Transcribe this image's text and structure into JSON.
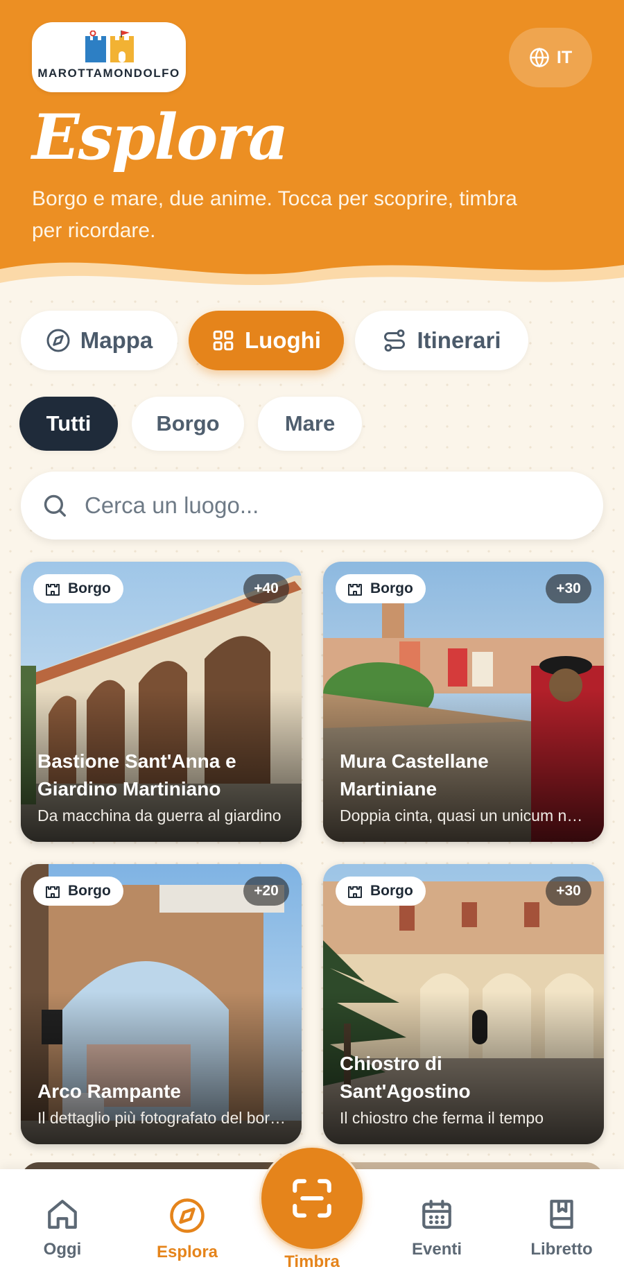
{
  "header": {
    "brand": "MAROTTAMONDOLFO",
    "language": "IT",
    "title": "Esplora",
    "subtitle": "Borgo e mare, due anime. Tocca per scoprire, timbra per ricordare."
  },
  "view_tabs": [
    {
      "label": "Mappa",
      "icon": "compass-icon",
      "active": false
    },
    {
      "label": "Luoghi",
      "icon": "grid-icon",
      "active": true
    },
    {
      "label": "Itinerari",
      "icon": "route-icon",
      "active": false
    }
  ],
  "filters": [
    {
      "label": "Tutti",
      "active": true
    },
    {
      "label": "Borgo",
      "active": false
    },
    {
      "label": "Mare",
      "active": false
    }
  ],
  "search": {
    "placeholder": "Cerca un luogo..."
  },
  "places": [
    {
      "category": "Borgo",
      "points": "+40",
      "name_line1": "Bastione Sant'Anna e",
      "name_line2": "Giardino Martiniano",
      "description": "Da macchina da guerra al giardino"
    },
    {
      "category": "Borgo",
      "points": "+30",
      "name_line1": "Mura Castellane",
      "name_line2": "Martiniane",
      "description": "Doppia cinta, quasi un unicum nelle Marche"
    },
    {
      "category": "Borgo",
      "points": "+20",
      "name_line1": "",
      "name_line2": "Arco Rampante",
      "description": "Il dettaglio più fotografato del borgo"
    },
    {
      "category": "Borgo",
      "points": "+30",
      "name_line1": "Chiostro di",
      "name_line2": "Sant'Agostino",
      "description": "Il chiostro che ferma il tempo"
    }
  ],
  "bottom_nav": {
    "home": "Oggi",
    "explore": "Esplora",
    "stamp": "Timbra",
    "events": "Eventi",
    "booklet": "Libretto"
  },
  "colors": {
    "accent": "#e5841b",
    "header": "#ec8f23",
    "background": "#fbf5ea",
    "dark": "#1f2b3a"
  }
}
